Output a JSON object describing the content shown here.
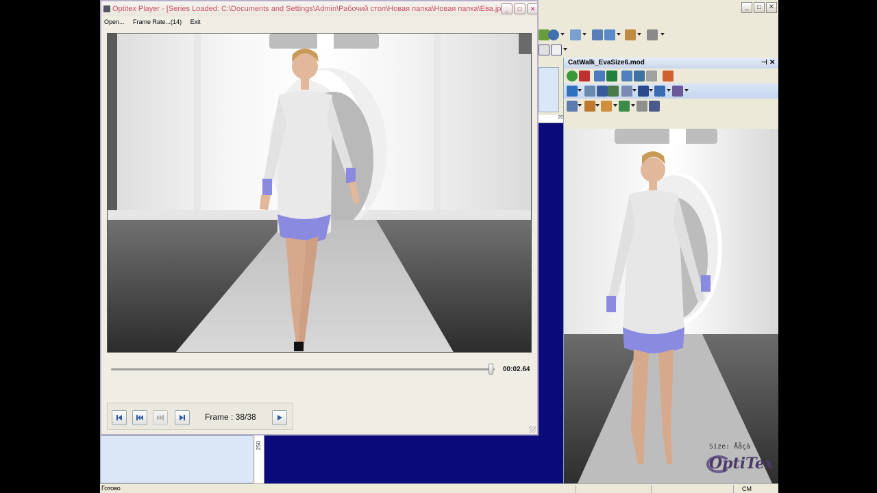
{
  "player": {
    "title": "Optitex Player - [Series Loaded: C:\\Documents and Settings\\Admin\\Рабочий стол\\Новая папка\\Новая папка\\Ева.jpg]",
    "menu": {
      "open": "Open...",
      "frame_rate": "Frame Rate...(14)",
      "exit": "Exit"
    },
    "time": "00:02.64",
    "progress": 0.99,
    "frame_label": "Frame : 38/38",
    "controls": [
      "first-frame",
      "step-back",
      "step-forward",
      "last-frame",
      "play"
    ]
  },
  "catwalk_panel": {
    "title": "CatWalk_EvaSize6.mod",
    "size_label": "Size: Ååçà",
    "logo": "OptiTex"
  },
  "ruler": {
    "mark_250": "250",
    "mark_20": "20"
  },
  "statusbar": {
    "ready": "Готово",
    "unit": "CM"
  },
  "colors": {
    "accent_title": "#c8506a",
    "workspace": "#0a0a7a",
    "panel_blue": "#dbe7f7"
  }
}
